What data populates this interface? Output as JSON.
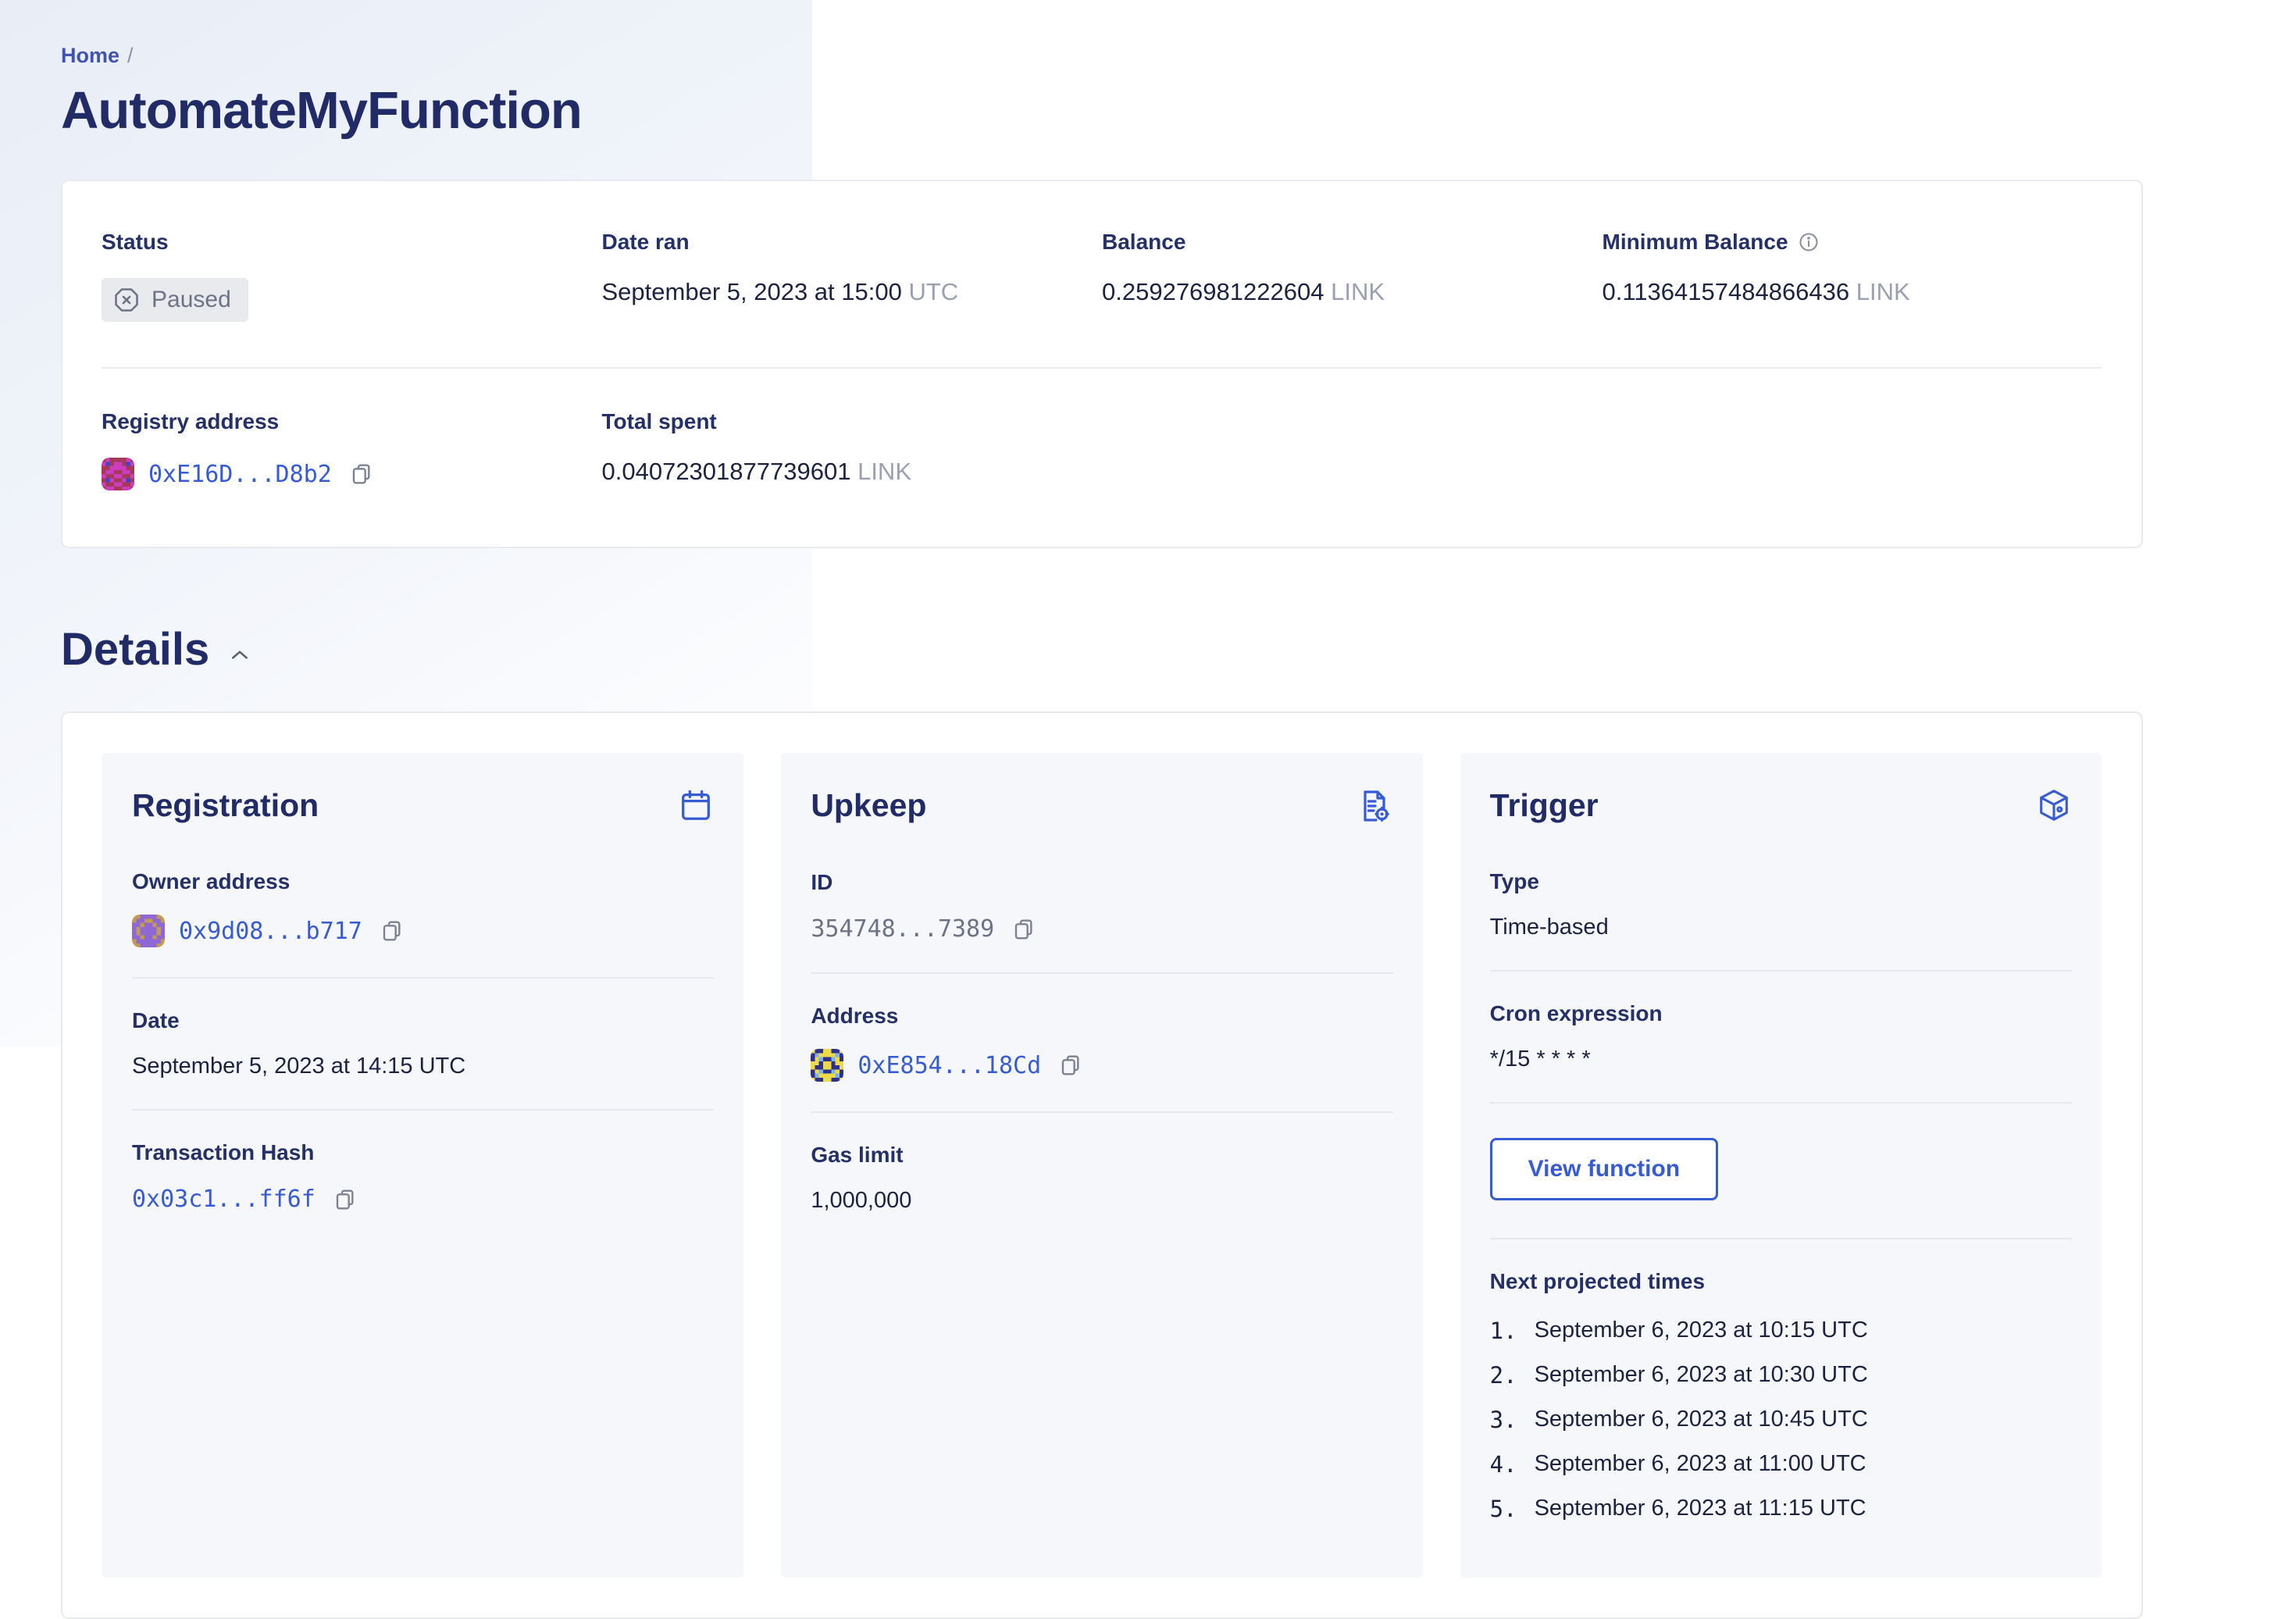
{
  "breadcrumb": {
    "home": "Home",
    "separator": "/"
  },
  "page": {
    "title": "AutomateMyFunction"
  },
  "summary": {
    "status": {
      "label": "Status",
      "badge": "Paused"
    },
    "date_ran": {
      "label": "Date ran",
      "value": "September 5, 2023 at 15:00",
      "suffix": "UTC"
    },
    "balance": {
      "label": "Balance",
      "value": "0.259276981222604",
      "unit": "LINK"
    },
    "min_balance": {
      "label": "Minimum Balance",
      "value": "0.11364157484866436",
      "unit": "LINK"
    },
    "registry": {
      "label": "Registry address",
      "address": "0xE16D...D8b2"
    },
    "total_spent": {
      "label": "Total spent",
      "value": "0.04072301877739601",
      "unit": "LINK"
    }
  },
  "details": {
    "heading": "Details",
    "registration": {
      "title": "Registration",
      "owner_label": "Owner address",
      "owner_address": "0x9d08...b717",
      "date_label": "Date",
      "date_value": "September 5, 2023 at 14:15 UTC",
      "tx_label": "Transaction Hash",
      "tx_value": "0x03c1...ff6f"
    },
    "upkeep": {
      "title": "Upkeep",
      "id_label": "ID",
      "id_value": "354748...7389",
      "address_label": "Address",
      "address_value": "0xE854...18Cd",
      "gas_label": "Gas limit",
      "gas_value": "1,000,000"
    },
    "trigger": {
      "title": "Trigger",
      "type_label": "Type",
      "type_value": "Time-based",
      "cron_label": "Cron expression",
      "cron_value": "*/15 * * * *",
      "button_label": "View function",
      "next_label": "Next projected times",
      "next_times": [
        {
          "num": "1.",
          "text": "September 6, 2023 at 10:15 UTC"
        },
        {
          "num": "2.",
          "text": "September 6, 2023 at 10:30 UTC"
        },
        {
          "num": "3.",
          "text": "September 6, 2023 at 10:45 UTC"
        },
        {
          "num": "4.",
          "text": "September 6, 2023 at 11:00 UTC"
        },
        {
          "num": "5.",
          "text": "September 6, 2023 at 11:15 UTC"
        }
      ]
    }
  },
  "avatars": {
    "registry": {
      "bg": "#cb3cbe",
      "primary": "#a23a58",
      "spot": "#4143c6"
    },
    "owner": {
      "bg": "#8e68d5",
      "primary": "#c49a52",
      "spot": "#b09ae3"
    },
    "upkeep": {
      "bg": "#2e3090",
      "primary": "#eed94b",
      "spot": "#7fb3e6"
    }
  },
  "colors": {
    "accent_blue": "#375bd2",
    "heading_navy": "#212b66",
    "label_navy": "#243066",
    "value_dark": "#1c2340",
    "gray_text": "#6d7386",
    "muted_gray": "#9aa0b0",
    "badge_bg": "#e9eaee",
    "card_border": "#e9eaef",
    "inner_card_bg": "#f6f7fa"
  },
  "icons": [
    "paused-octagon-x-icon",
    "info-icon",
    "copy-icon",
    "identicon-avatar",
    "chevron-up-icon",
    "calendar-icon",
    "document-gear-icon",
    "cube-icon"
  ]
}
